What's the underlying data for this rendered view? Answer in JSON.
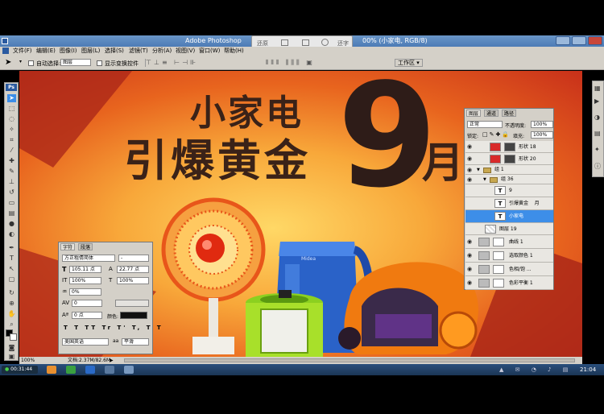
{
  "window": {
    "title": "Adobe Photoshop",
    "title_suffix": "00% (小家电, RGB/8)"
  },
  "video_controls": {
    "label_left": "还原",
    "label_right": "还字"
  },
  "menu": [
    "文件(F)",
    "编辑(E)",
    "图像(I)",
    "图层(L)",
    "选择(S)",
    "滤镜(T)",
    "分析(A)",
    "视图(V)",
    "窗口(W)",
    "帮助(H)"
  ],
  "options_bar": {
    "auto_select_label": "自动选择:",
    "auto_select_value": "图层",
    "transform_label": "显示变换控件",
    "workspace_label": "工作区 ▾"
  },
  "toolbox": {
    "logo": "Ps"
  },
  "canvas": {
    "headline_line1": "小家电",
    "headline_line2": "引爆黄金",
    "big_number": "9",
    "month": "月",
    "kettle_brand": "Midea"
  },
  "character_panel": {
    "tabs": [
      "字符",
      "段落"
    ],
    "font_family": "方正粗倩简体",
    "font_style": "-",
    "font_size": "105.11 点",
    "leading": "22.77 点",
    "scale_v": "100%",
    "scale_h": "100%",
    "tracking": "0%",
    "kerning": "0",
    "baseline": "0 点",
    "color_label": "颜色:",
    "language": "美国英语",
    "antialias": "平滑"
  },
  "layers_panel": {
    "tabs": [
      "图层",
      "通道",
      "路径"
    ],
    "blend_mode": "正常",
    "opacity_label": "不透明度:",
    "opacity": "100%",
    "lock_label": "锁定:",
    "fill_label": "填充:",
    "fill": "100%",
    "rows": [
      {
        "name": "形状 18",
        "kind": "shape"
      },
      {
        "name": "形状 20",
        "kind": "shape"
      },
      {
        "name": "组 1",
        "kind": "group"
      },
      {
        "name": "组 36",
        "kind": "group"
      },
      {
        "name": "9",
        "kind": "text"
      },
      {
        "name": "引爆黄金    月",
        "kind": "text"
      },
      {
        "name": "小家电",
        "kind": "text",
        "selected": true
      },
      {
        "name": "图层 19",
        "kind": "layer"
      },
      {
        "name": "曲线 1",
        "kind": "adj"
      },
      {
        "name": "选取颜色 1",
        "kind": "adj"
      },
      {
        "name": "色相/饱 ...",
        "kind": "adj"
      },
      {
        "name": "色彩平衡 1",
        "kind": "adj"
      }
    ]
  },
  "status_bar": {
    "zoom": "100%",
    "doc_info": "文档:2.37M/82.6M"
  },
  "taskbar": {
    "recording_time": "00:31:44",
    "clock": "21:04"
  },
  "colors": {
    "accent": "#3d8ee8",
    "ui_gray": "#d4d0c8",
    "headline": "#3a2218"
  }
}
